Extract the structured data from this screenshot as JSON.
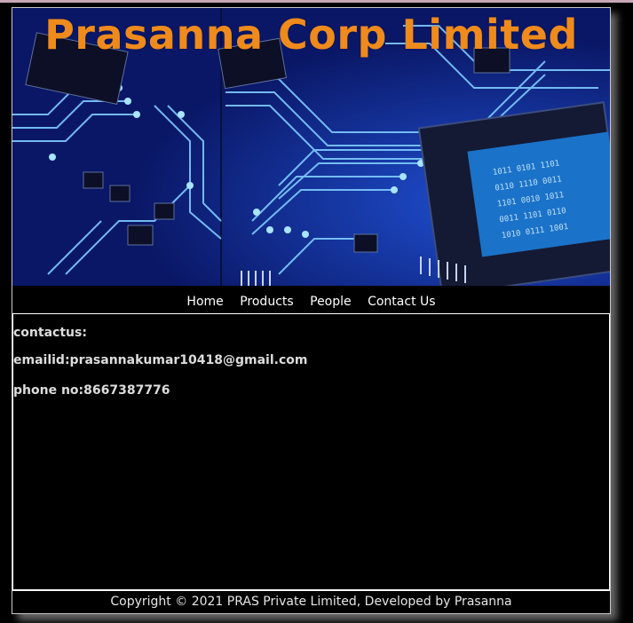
{
  "header": {
    "title": "Prasanna Corp Limited"
  },
  "banner": {
    "image": "circuit-board-image"
  },
  "nav": {
    "items": [
      {
        "label": "Home"
      },
      {
        "label": "Products"
      },
      {
        "label": "People"
      },
      {
        "label": "Contact Us"
      }
    ]
  },
  "contact": {
    "heading": "contactus:",
    "email": "emailid:prasannakumar10418@gmail.com",
    "phone": "phone no:8667387776"
  },
  "footer": {
    "text": "Copyright © 2021 PRAS Private Limited, Developed by Prasanna"
  },
  "colors": {
    "title": "#ef8a1c",
    "background": "#000000",
    "circuit_bg": "#0b1a6a",
    "trace": "#8fd4ff"
  }
}
